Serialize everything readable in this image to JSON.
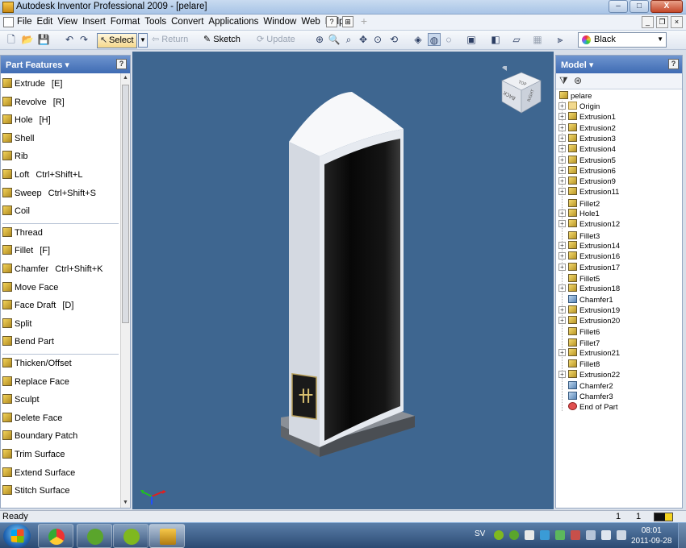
{
  "window": {
    "title": "Autodesk Inventor Professional 2009 - [pelare]",
    "min_label": "–",
    "max_label": "□",
    "close_label": "X"
  },
  "menubar": {
    "items": [
      "File",
      "Edit",
      "View",
      "Insert",
      "Format",
      "Tools",
      "Convert",
      "Applications",
      "Window",
      "Web",
      "Help"
    ]
  },
  "toolbar": {
    "select_label": "Select",
    "return_label": "Return",
    "sketch_label": "Sketch",
    "update_label": "Update",
    "color_value": "Black"
  },
  "left_panel": {
    "title": "Part Features",
    "help_label": "?",
    "features": [
      {
        "label": "Extrude",
        "shortcut": "[E]"
      },
      {
        "label": "Revolve",
        "shortcut": "[R]"
      },
      {
        "label": "Hole",
        "shortcut": "[H]"
      },
      {
        "label": "Shell",
        "shortcut": ""
      },
      {
        "label": "Rib",
        "shortcut": ""
      },
      {
        "label": "Loft",
        "shortcut": "Ctrl+Shift+L"
      },
      {
        "label": "Sweep",
        "shortcut": "Ctrl+Shift+S"
      },
      {
        "label": "Coil",
        "shortcut": ""
      },
      {
        "label": "Thread",
        "shortcut": ""
      },
      {
        "label": "Fillet",
        "shortcut": "[F]"
      },
      {
        "label": "Chamfer",
        "shortcut": "Ctrl+Shift+K"
      },
      {
        "label": "Move Face",
        "shortcut": ""
      },
      {
        "label": "Face Draft",
        "shortcut": "[D]"
      },
      {
        "label": "Split",
        "shortcut": ""
      },
      {
        "label": "Bend Part",
        "shortcut": ""
      },
      {
        "label": "Thicken/Offset",
        "shortcut": ""
      },
      {
        "label": "Replace Face",
        "shortcut": ""
      },
      {
        "label": "Sculpt",
        "shortcut": ""
      },
      {
        "label": "Delete Face",
        "shortcut": ""
      },
      {
        "label": "Boundary Patch",
        "shortcut": ""
      },
      {
        "label": "Trim Surface",
        "shortcut": ""
      },
      {
        "label": "Extend Surface",
        "shortcut": ""
      },
      {
        "label": "Stitch Surface",
        "shortcut": ""
      }
    ]
  },
  "viewcube": {
    "top_label": "TOP",
    "front_label": "BACK",
    "right_label": "RIGHT"
  },
  "right_panel": {
    "title": "Model",
    "help_label": "?",
    "root": "pelare",
    "nodes": [
      {
        "label": "Origin",
        "kind": "folder"
      },
      {
        "label": "Extrusion1",
        "kind": "feature"
      },
      {
        "label": "Extrusion2",
        "kind": "feature"
      },
      {
        "label": "Extrusion3",
        "kind": "feature"
      },
      {
        "label": "Extrusion4",
        "kind": "feature"
      },
      {
        "label": "Extrusion5",
        "kind": "feature"
      },
      {
        "label": "Extrusion6",
        "kind": "feature"
      },
      {
        "label": "Extrusion9",
        "kind": "feature"
      },
      {
        "label": "Extrusion11",
        "kind": "feature"
      },
      {
        "label": "Fillet2",
        "kind": "leaf"
      },
      {
        "label": "Hole1",
        "kind": "feature"
      },
      {
        "label": "Extrusion12",
        "kind": "feature"
      },
      {
        "label": "Fillet3",
        "kind": "leaf"
      },
      {
        "label": "Extrusion14",
        "kind": "feature"
      },
      {
        "label": "Extrusion16",
        "kind": "feature"
      },
      {
        "label": "Extrusion17",
        "kind": "feature"
      },
      {
        "label": "Fillet5",
        "kind": "leaf"
      },
      {
        "label": "Extrusion18",
        "kind": "feature"
      },
      {
        "label": "Chamfer1",
        "kind": "chamfer"
      },
      {
        "label": "Extrusion19",
        "kind": "feature"
      },
      {
        "label": "Extrusion20",
        "kind": "feature"
      },
      {
        "label": "Fillet6",
        "kind": "leaf"
      },
      {
        "label": "Fillet7",
        "kind": "leaf"
      },
      {
        "label": "Extrusion21",
        "kind": "feature"
      },
      {
        "label": "Fillet8",
        "kind": "leaf"
      },
      {
        "label": "Extrusion22",
        "kind": "feature"
      },
      {
        "label": "Chamfer2",
        "kind": "chamfer"
      },
      {
        "label": "Chamfer3",
        "kind": "chamfer"
      },
      {
        "label": "End of Part",
        "kind": "end"
      }
    ]
  },
  "statusbar": {
    "text": "Ready",
    "count_a": "1",
    "count_b": "1"
  },
  "taskbar": {
    "language": "SV",
    "time": "08:01",
    "date": "2011-09-28"
  },
  "colors": {
    "viewport_bg": "#3e6690",
    "panel_header": "#4a74b8",
    "part_white": "#eef1f6",
    "panel_black": "#0c0c0c"
  }
}
